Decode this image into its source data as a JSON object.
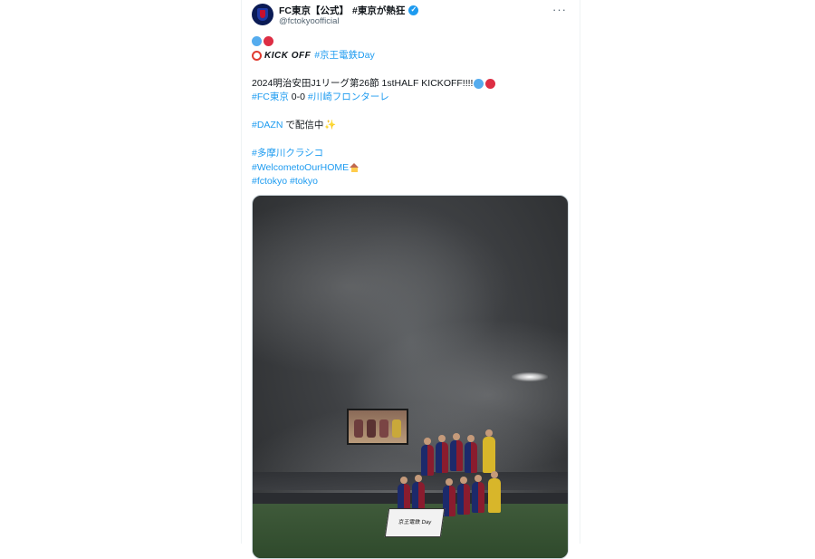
{
  "author": {
    "name": "FC東京【公式】",
    "name_suffix": "#東京が熱狂",
    "handle": "@fctokyoofficial",
    "verified_color": "#1d9bf0"
  },
  "menu": {
    "more_label": "···"
  },
  "tweet": {
    "kickoff_label": "KICK OFF",
    "hashtag_keio": "#京王電鉄Day",
    "match_line": "2024明治安田J1リーグ第26節 1stHALF KICKOFF!!!!",
    "hashtag_fctokyo": "#FC東京",
    "score": " 0-0 ",
    "hashtag_kawasaki": "#川崎フロンターレ",
    "hashtag_dazn": "#DAZN",
    "dazn_text": " で配信中",
    "hashtag_tama": "#多摩川クラシコ",
    "hashtag_home": "#WelcometoOurHOME",
    "hashtag_fctokyo_en": "#fctokyo",
    "hashtag_tokyo": "#tokyo"
  },
  "photo": {
    "banner_text": "京王電鉄 Day",
    "subject": "team-photo-on-foggy-pitch"
  },
  "colors": {
    "hashtag": "#1d9bf0",
    "club_blue": "#55acee",
    "club_red": "#dd2e44"
  },
  "icons": {
    "blue_circle": "blue-circle-icon",
    "red_circle": "red-circle-icon",
    "alarm_clock": "alarm-clock-icon",
    "sparkles": "sparkles-icon",
    "house": "house-icon",
    "more": "more-icon",
    "verified": "verified-badge-icon"
  }
}
